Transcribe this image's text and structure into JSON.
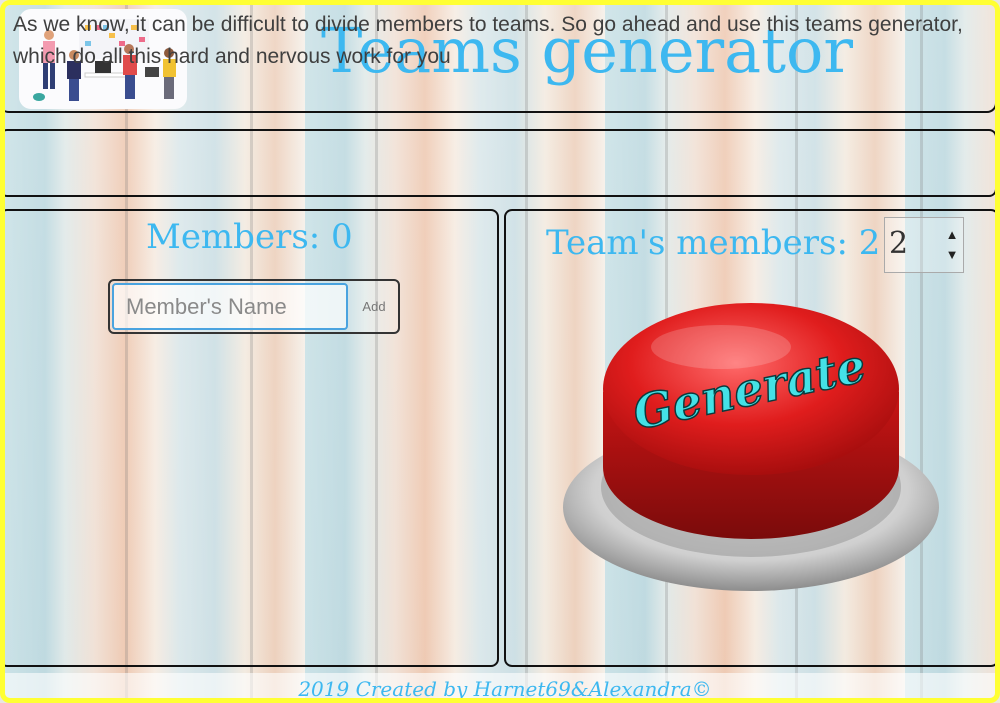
{
  "header": {
    "title": "Teams generator",
    "logo_icon": "team-illustration-icon"
  },
  "intro": {
    "text": "As we know, it can be difficult to divide members to teams. So go ahead and use this teams generator, which do all this hard and nervous work for you"
  },
  "members": {
    "title": "Members: 0",
    "input_placeholder": "Member's Name",
    "input_value": "",
    "add_label": "Add"
  },
  "team": {
    "title": "Team's members: 2",
    "stepper_value": "2",
    "up_icon": "triangle-up-icon",
    "down_icon": "triangle-down-icon"
  },
  "generate": {
    "label": "Generate",
    "button_color": "#d41818",
    "text_color": "#44e1e6"
  },
  "footer": {
    "text": "2019 Created by Harnet69&Alexandra©"
  },
  "colors": {
    "accent": "#3db8f0",
    "frame": "#ffff33"
  }
}
